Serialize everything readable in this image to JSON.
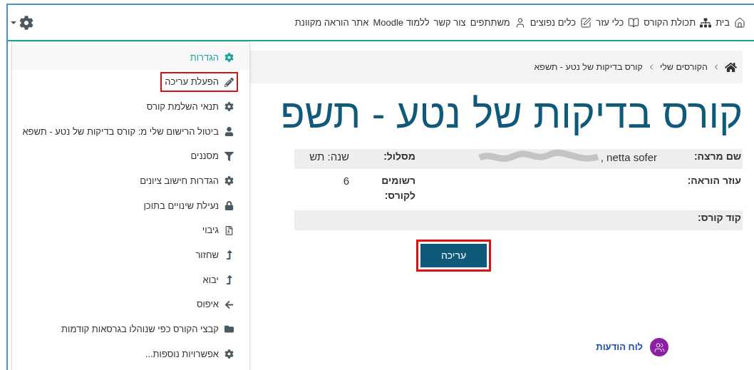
{
  "nav": {
    "items": [
      {
        "label": "בית"
      },
      {
        "label": "תכולת הקורס"
      },
      {
        "label": "כלי עזר"
      },
      {
        "label": "כלים נפוצים"
      },
      {
        "label": "משתתפים"
      },
      {
        "label": "צור קשר"
      },
      {
        "label": "ללמוד Moodle"
      },
      {
        "label": "אתר הוראה מקוונת"
      }
    ]
  },
  "settings_menu": {
    "items": [
      {
        "label": "הגדרות",
        "selected": true,
        "annotated": false
      },
      {
        "label": "הפעלת עריכה",
        "selected": false,
        "annotated": true
      },
      {
        "label": "תנאי השלמת קורס",
        "selected": false,
        "annotated": false
      },
      {
        "label": "ביטול הרישום שלי מ: קורס בדיקות של נטע - תשפא",
        "selected": false,
        "annotated": false
      },
      {
        "label": "מסננים",
        "selected": false,
        "annotated": false
      },
      {
        "label": "הגדרות חישוב ציונים",
        "selected": false,
        "annotated": false
      },
      {
        "label": "נעילת שינויים בתוכן",
        "selected": false,
        "annotated": false
      },
      {
        "label": "גיבוי",
        "selected": false,
        "annotated": false
      },
      {
        "label": "שחזור",
        "selected": false,
        "annotated": false
      },
      {
        "label": "יבוא",
        "selected": false,
        "annotated": false
      },
      {
        "label": "איפוס",
        "selected": false,
        "annotated": false
      },
      {
        "label": "קבצי הקורס כפי שנוהלו בגרסאות קודמות",
        "selected": false,
        "annotated": false
      },
      {
        "label": "אפשרויות נוספות...",
        "selected": false,
        "annotated": false
      }
    ]
  },
  "breadcrumb": [
    "הקורסים שלי",
    "קורס בדיקות של נטע - תשפא"
  ],
  "title": "קורס בדיקות של נטע - תשפ",
  "info_table": {
    "rows": [
      {
        "cells": [
          {
            "label": "שם מרצה:",
            "value": ", netta sofer",
            "redacted": true
          },
          {
            "label": "מסלול:",
            "value": "שנה: תש"
          }
        ]
      },
      {
        "cells": [
          {
            "label": "עוזר הוראה:"
          },
          {
            "label": "רשומים לקורס:",
            "value": "6"
          }
        ]
      },
      {
        "cells": [
          {
            "label": "קוד קורס:"
          }
        ]
      }
    ]
  },
  "edit_button": {
    "label": "עריכה",
    "annotated": true
  },
  "forum_link": "לוח הודעות"
}
